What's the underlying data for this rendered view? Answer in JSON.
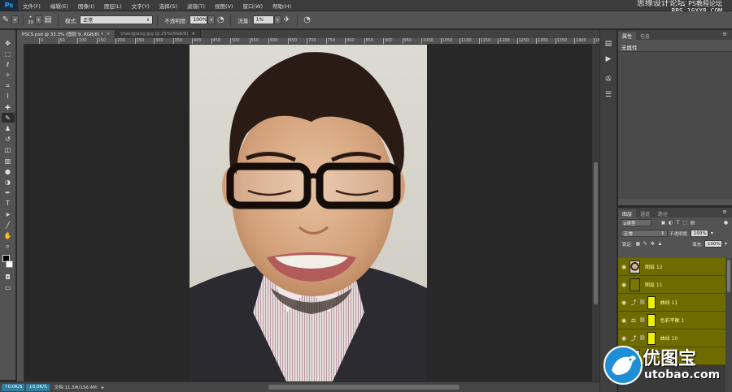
{
  "app": {
    "logo": "Ps"
  },
  "menu": [
    "文件(F)",
    "编辑(E)",
    "图像(I)",
    "图层(L)",
    "文字(Y)",
    "选择(S)",
    "滤镜(T)",
    "视图(V)",
    "窗口(W)",
    "帮助(H)"
  ],
  "watermark_top": {
    "line1": "思缘设计论坛",
    "line2": "PS教程论坛",
    "line3": "BBS.16XX8.COM"
  },
  "options": {
    "brush_size": "30",
    "mode_label": "模式:",
    "mode_value": "正常",
    "opacity_label": "不透明度:",
    "opacity_value": "100%",
    "flow_label": "流量:",
    "flow_value": "1%"
  },
  "tabs": [
    {
      "label": "PSCS.psd @ 33.3% (图层 9, RGB/8) *",
      "active": true
    },
    {
      "label": "changjiang.jpg @ 25%(RGB/8)",
      "active": false
    }
  ],
  "ruler_ticks": [
    "0",
    "50",
    "100",
    "150",
    "200",
    "250",
    "300",
    "350",
    "400",
    "450",
    "500",
    "550",
    "600",
    "650",
    "700",
    "750",
    "800",
    "850",
    "900",
    "950",
    "1000",
    "1050",
    "1100",
    "1150",
    "1200",
    "1250",
    "1300",
    "1350",
    "1400",
    "1450",
    "1500"
  ],
  "status": {
    "perf1": "0.0K/S",
    "perf2": "0.0K/S",
    "doc_info": "文档:11.5M/156.4M"
  },
  "properties": {
    "tabs": [
      "属性",
      "信息"
    ],
    "text": "无属性"
  },
  "layers": {
    "tabs": [
      "图层",
      "通道",
      "路径"
    ],
    "filter_type": "ρ类型",
    "blend_mode": "正常",
    "opacity_label": "不透明度:",
    "opacity_value": "100%",
    "lock_label": "锁定:",
    "fill_label": "填充:",
    "fill_value": "100%",
    "items": [
      {
        "name": "图层 12",
        "kind": "photo"
      },
      {
        "name": "图层 11",
        "kind": "olive"
      },
      {
        "name": "曲线 11",
        "kind": "curves"
      },
      {
        "name": "色彩平衡 1",
        "kind": "balance"
      },
      {
        "name": "曲线 10",
        "kind": "curves"
      },
      {
        "name": "图层 9",
        "kind": "photo"
      }
    ]
  },
  "watermark_bottom": {
    "name": "优图宝",
    "url": "utobao.com"
  }
}
